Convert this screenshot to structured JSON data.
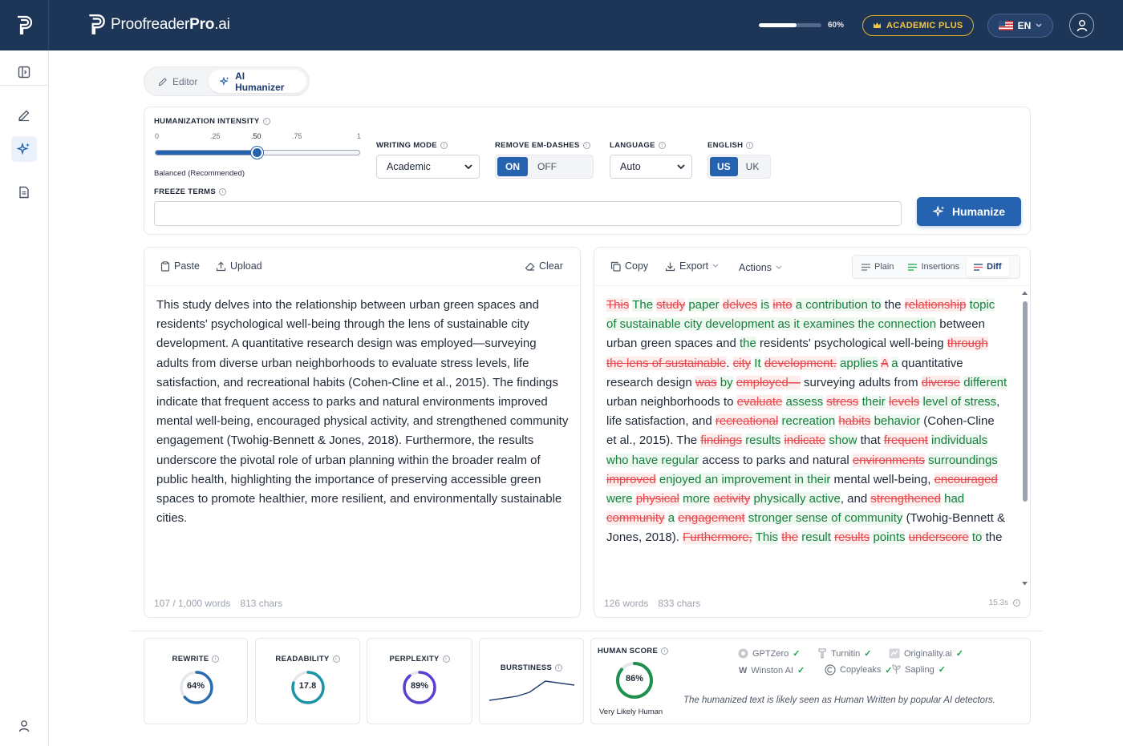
{
  "brand": {
    "name_part1": "Proofreader",
    "name_part2": "Pro",
    "name_part3": ".ai"
  },
  "header": {
    "progress_percent": 60,
    "progress_label": "60%",
    "plan_label": "ACADEMIC PLUS",
    "language_label": "EN",
    "colors": {
      "bar": "#1d3557",
      "accent": "#2563b0",
      "gold": "#f4c542"
    }
  },
  "sidebar": {
    "items": [
      "collapse-sidebar-icon",
      "pencil-icon",
      "sparkles-icon",
      "document-icon"
    ],
    "active_index": 2
  },
  "mode_tabs": [
    {
      "label": "Editor",
      "active": false
    },
    {
      "label": "AI Humanizer",
      "active": true
    }
  ],
  "settings": {
    "intensity": {
      "label": "HUMANIZATION INTENSITY",
      "ticks": [
        "0",
        ".25",
        ".50",
        ".75",
        "1"
      ],
      "value": 0.5,
      "caption": "Balanced (Recommended)"
    },
    "writing_mode": {
      "label": "WRITING MODE",
      "value": "Academic"
    },
    "em_dashes": {
      "label": "REMOVE EM-DASHES",
      "on": "ON",
      "off": "OFF",
      "selected": "ON"
    },
    "language": {
      "label": "LANGUAGE",
      "value": "Auto"
    },
    "english": {
      "label": "ENGLISH",
      "us": "US",
      "uk": "UK",
      "selected": "US"
    },
    "freeze": {
      "label": "FREEZE TERMS",
      "value": ""
    },
    "humanize_button": "Humanize"
  },
  "input_panel": {
    "paste": "Paste",
    "upload": "Upload",
    "clear": "Clear",
    "text": "This study delves into the relationship between urban green spaces and residents' psychological well-being through the lens of sustainable city development. A quantitative research design was employed—surveying adults from diverse urban neighborhoods to evaluate stress levels, life satisfaction, and recreational habits (Cohen-Cline et al., 2015). The findings indicate that frequent access to parks and natural environments improved mental well-being, encouraged physical activity, and strengthened community engagement (Twohig-Bennett & Jones, 2018). Furthermore, the results underscore the pivotal role of urban planning within the broader realm of public health, highlighting the importance of preserving accessible green spaces to promote healthier, more resilient, and environmentally sustainable cities.",
    "word_count": "107 / 1,000 words",
    "char_count": "813 chars"
  },
  "output_panel": {
    "copy": "Copy",
    "export": "Export",
    "actions": "Actions",
    "views": [
      {
        "label": "Plain",
        "active": false
      },
      {
        "label": "Insertions",
        "active": false
      },
      {
        "label": "Diff",
        "active": true
      }
    ],
    "diff": [
      {
        "t": "del",
        "s": "This"
      },
      {
        "t": "ins",
        "s": "The"
      },
      {
        "t": "del",
        "s": "study"
      },
      {
        "t": "ins",
        "s": "paper"
      },
      {
        "t": "del",
        "s": "delves"
      },
      {
        "t": "ins",
        "s": "is"
      },
      {
        "t": "del",
        "s": "into"
      },
      {
        "t": "ins",
        "s": "a contribution to"
      },
      {
        "t": "eq",
        "s": "the"
      },
      {
        "t": "del",
        "s": "relationship"
      },
      {
        "t": "ins",
        "s": "topic of sustainable city development as it examines the connection"
      },
      {
        "t": "eq",
        "s": "between urban green spaces and"
      },
      {
        "t": "ins",
        "s": "the"
      },
      {
        "t": "eq",
        "s": "residents' psychological well-being"
      },
      {
        "t": "del",
        "s": "through the lens of sustainable"
      },
      {
        "t": "eq",
        "s": "."
      },
      {
        "t": "del",
        "s": "city"
      },
      {
        "t": "ins",
        "s": "It"
      },
      {
        "t": "del",
        "s": "development."
      },
      {
        "t": "ins",
        "s": "applies"
      },
      {
        "t": "del",
        "s": "A"
      },
      {
        "t": "ins",
        "s": "a"
      },
      {
        "t": "eq",
        "s": "quantitative research design"
      },
      {
        "t": "del",
        "s": "was"
      },
      {
        "t": "ins",
        "s": "by"
      },
      {
        "t": "del",
        "s": "employed—"
      },
      {
        "t": "eq",
        "s": "surveying adults from"
      },
      {
        "t": "del",
        "s": "diverse"
      },
      {
        "t": "ins",
        "s": "different"
      },
      {
        "t": "eq",
        "s": "urban neighborhoods to"
      },
      {
        "t": "del",
        "s": "evaluate"
      },
      {
        "t": "ins",
        "s": "assess"
      },
      {
        "t": "del",
        "s": "stress"
      },
      {
        "t": "ins",
        "s": "their"
      },
      {
        "t": "del",
        "s": "levels"
      },
      {
        "t": "ins",
        "s": "level of stress"
      },
      {
        "t": "eq",
        "s": ", life satisfaction, and"
      },
      {
        "t": "del",
        "s": "recreational"
      },
      {
        "t": "ins",
        "s": "recreation"
      },
      {
        "t": "del",
        "s": "habits"
      },
      {
        "t": "ins",
        "s": "behavior"
      },
      {
        "t": "eq",
        "s": "(Cohen-Cline et al., 2015). The"
      },
      {
        "t": "del",
        "s": "findings"
      },
      {
        "t": "ins",
        "s": "results"
      },
      {
        "t": "del",
        "s": "indicate"
      },
      {
        "t": "ins",
        "s": "show"
      },
      {
        "t": "eq",
        "s": "that"
      },
      {
        "t": "del",
        "s": "frequent"
      },
      {
        "t": "ins",
        "s": "individuals who have regular"
      },
      {
        "t": "eq",
        "s": "access to parks and natural"
      },
      {
        "t": "del",
        "s": "environments"
      },
      {
        "t": "ins",
        "s": "surroundings"
      },
      {
        "t": "del",
        "s": "improved"
      },
      {
        "t": "ins",
        "s": "enjoyed an improvement in their"
      },
      {
        "t": "eq",
        "s": "mental well-being,"
      },
      {
        "t": "del",
        "s": "encouraged"
      },
      {
        "t": "ins",
        "s": "were"
      },
      {
        "t": "del",
        "s": "physical"
      },
      {
        "t": "ins",
        "s": "more"
      },
      {
        "t": "del",
        "s": "activity"
      },
      {
        "t": "ins",
        "s": "physically active"
      },
      {
        "t": "eq",
        "s": ", and"
      },
      {
        "t": "del",
        "s": "strengthened"
      },
      {
        "t": "ins",
        "s": "had"
      },
      {
        "t": "del",
        "s": "community"
      },
      {
        "t": "ins",
        "s": "a"
      },
      {
        "t": "del",
        "s": "engagement"
      },
      {
        "t": "ins",
        "s": "stronger sense of community"
      },
      {
        "t": "eq",
        "s": "(Twohig-Bennett & Jones, 2018)."
      },
      {
        "t": "del",
        "s": "Furthermore,"
      },
      {
        "t": "ins",
        "s": "This"
      },
      {
        "t": "del",
        "s": "the"
      },
      {
        "t": "ins",
        "s": "result"
      },
      {
        "t": "del",
        "s": "results"
      },
      {
        "t": "ins",
        "s": "points"
      },
      {
        "t": "del",
        "s": "underscore"
      },
      {
        "t": "ins",
        "s": "to"
      },
      {
        "t": "eq",
        "s": "the"
      }
    ],
    "word_count": "126 words",
    "char_count": "833 chars",
    "time": "15.3s"
  },
  "metrics": {
    "rewrite": {
      "label": "REWRITE",
      "value": "64%",
      "percent": 64,
      "color": "#2b6cb0"
    },
    "readability": {
      "label": "READABILITY",
      "value": "17.8",
      "percent": 80,
      "color": "#1b94a8"
    },
    "perplexity": {
      "label": "PERPLEXITY",
      "value": "89%",
      "percent": 89,
      "color": "#5b3fd1"
    },
    "burstiness": {
      "label": "BURSTINESS"
    }
  },
  "human_score": {
    "label": "HUMAN SCORE",
    "value": "86%",
    "percent": 86,
    "caption": "Very Likely Human",
    "color": "#1f8f4e",
    "detectors": [
      "GPTZero",
      "Turnitin",
      "Originality.ai",
      "Winston AI",
      "Copyleaks",
      "Sapling"
    ],
    "note": "The humanized text is likely seen as Human Written by popular AI detectors."
  }
}
